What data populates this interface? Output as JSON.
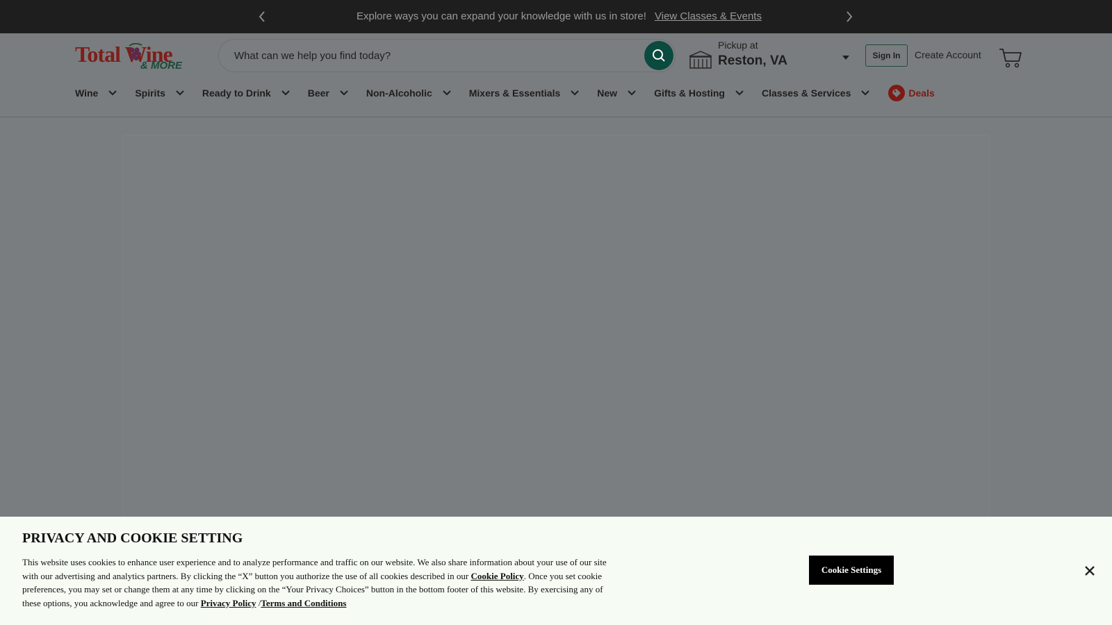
{
  "promo": {
    "message": "Explore ways you can expand your knowledge with us in store!",
    "link": "View Classes & Events",
    "prev_icon": "chevron-left-icon",
    "next_icon": "chevron-right-icon"
  },
  "header": {
    "logo": {
      "primary": "Total Wine",
      "secondary": "& MORE",
      "icon": "grape-icon"
    },
    "search": {
      "placeholder": "What can we help you find today?",
      "value": "",
      "icon": "search-icon"
    },
    "pickup": {
      "label": "Pickup at",
      "location": "Reston, VA",
      "icon": "store-icon"
    },
    "sign_in": "Sign In",
    "create_account": "Create Account",
    "cart_icon": "cart-icon"
  },
  "nav": {
    "items": [
      {
        "label": "Wine"
      },
      {
        "label": "Spirits"
      },
      {
        "label": "Ready to Drink"
      },
      {
        "label": "Beer"
      },
      {
        "label": "Non-Alcoholic"
      },
      {
        "label": "Mixers & Essentials"
      },
      {
        "label": "New"
      },
      {
        "label": "Gifts & Hosting"
      },
      {
        "label": "Classes & Services"
      }
    ],
    "deals": "Deals"
  },
  "cookie": {
    "title": "PRIVACY AND COOKIE SETTING",
    "text_1": "This website uses cookies to enhance user experience and to analyze performance and traffic on our website. We also share information about your use of our site with our advertising and analytics partners. By clicking the “X” button you authorize the use of all cookies described in our ",
    "cookie_policy": "Cookie Policy",
    "text_2": ". Once you set cookie preferences, you may set or change them at any time by clicking on the “Your Privacy Choices” button in the bottom footer of this website. By exercising any of these options, you acknowledge and agree to our ",
    "privacy_policy": "Privacy Policy",
    "separator": " /",
    "terms": "Terms and Conditions",
    "settings_button": "Cookie Settings",
    "close_icon": "close-icon"
  },
  "colors": {
    "promo_bg": "#1e1e1e",
    "overlay": "#7a7d7f",
    "brand_red": "#7e1e1a",
    "brand_green": "#0b4a3e",
    "cookie_bg": "#f6fbf4"
  }
}
